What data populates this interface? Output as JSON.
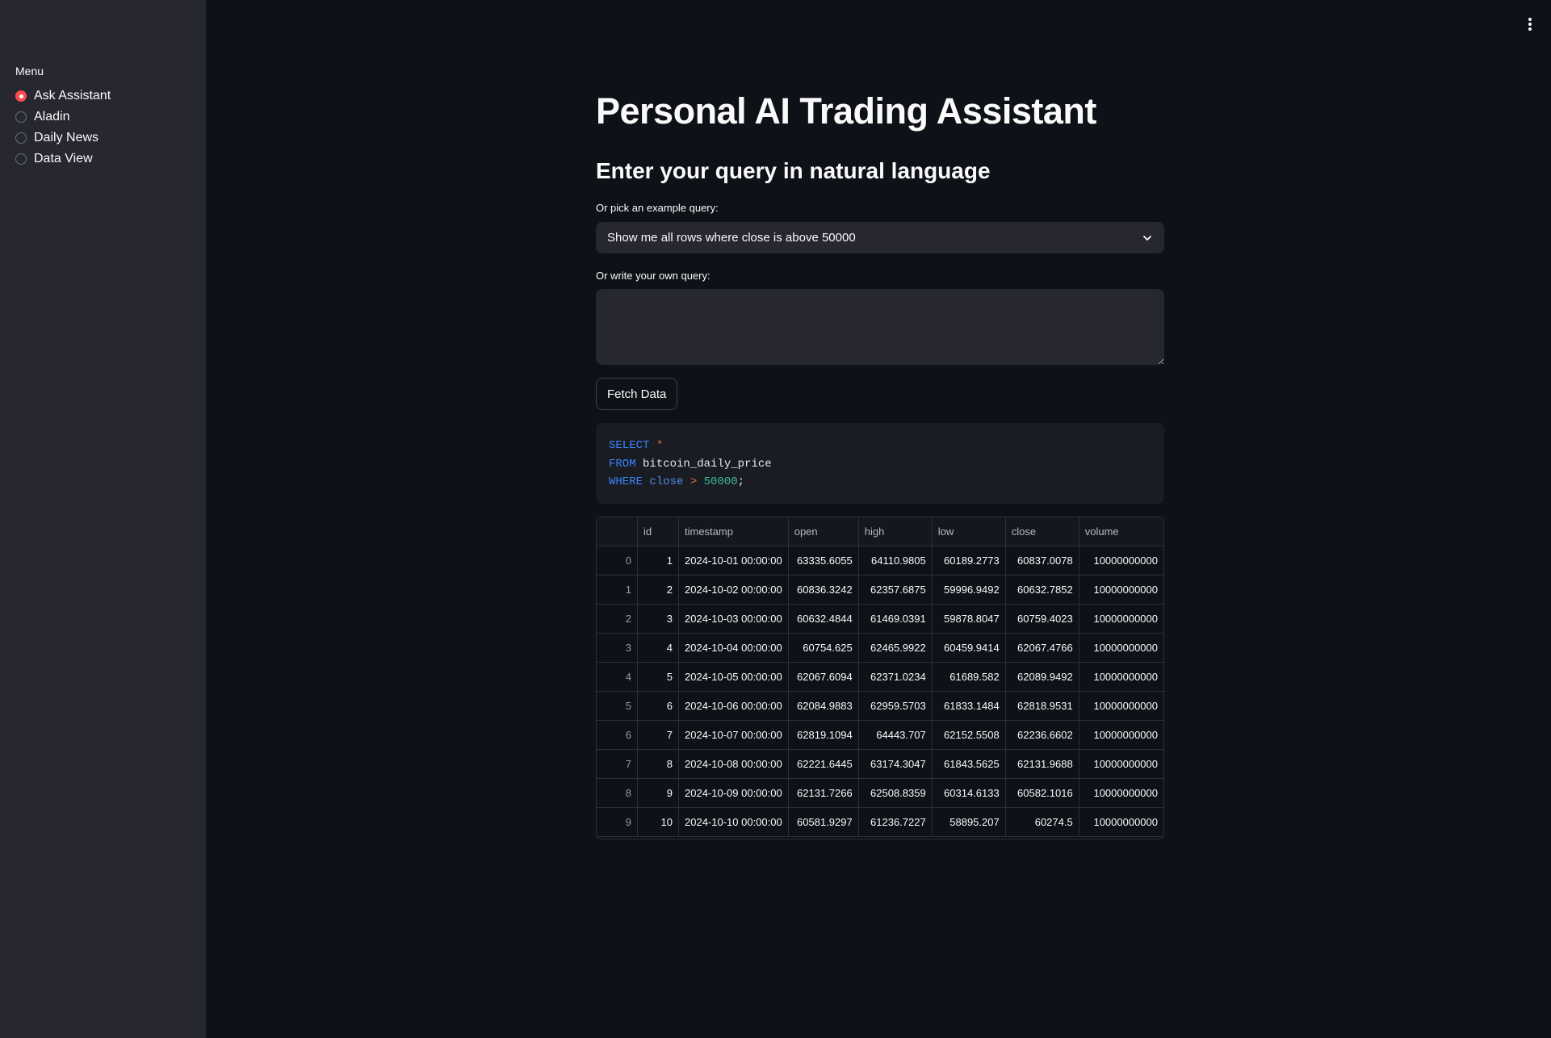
{
  "sidebar": {
    "menu_label": "Menu",
    "items": [
      {
        "label": "Ask Assistant",
        "selected": true
      },
      {
        "label": "Aladin",
        "selected": false
      },
      {
        "label": "Daily News",
        "selected": false
      },
      {
        "label": "Data View",
        "selected": false
      }
    ]
  },
  "header": {
    "menu_icon": "kebab-vertical-icon"
  },
  "main": {
    "title": "Personal AI Trading Assistant",
    "subtitle": "Enter your query in natural language",
    "example_label": "Or pick an example query:",
    "example_value": "Show me all rows where close is above 50000",
    "own_query_label": "Or write your own query:",
    "own_query_value": "",
    "fetch_button": "Fetch Data",
    "sql": {
      "l1_kw": "SELECT",
      "l1_op": "*",
      "l2_kw": "FROM",
      "l2_table": "bitcoin_daily_price",
      "l3_kw": "WHERE",
      "l3_col": "close",
      "l3_op": ">",
      "l3_num": "50000",
      "l3_end": ";"
    },
    "table": {
      "columns": [
        "",
        "id",
        "timestamp",
        "open",
        "high",
        "low",
        "close",
        "volume"
      ],
      "rows": [
        [
          "0",
          "1",
          "2024-10-01 00:00:00",
          "63335.6055",
          "64110.9805",
          "60189.2773",
          "60837.0078",
          "10000000000"
        ],
        [
          "1",
          "2",
          "2024-10-02 00:00:00",
          "60836.3242",
          "62357.6875",
          "59996.9492",
          "60632.7852",
          "10000000000"
        ],
        [
          "2",
          "3",
          "2024-10-03 00:00:00",
          "60632.4844",
          "61469.0391",
          "59878.8047",
          "60759.4023",
          "10000000000"
        ],
        [
          "3",
          "4",
          "2024-10-04 00:00:00",
          "60754.625",
          "62465.9922",
          "60459.9414",
          "62067.4766",
          "10000000000"
        ],
        [
          "4",
          "5",
          "2024-10-05 00:00:00",
          "62067.6094",
          "62371.0234",
          "61689.582",
          "62089.9492",
          "10000000000"
        ],
        [
          "5",
          "6",
          "2024-10-06 00:00:00",
          "62084.9883",
          "62959.5703",
          "61833.1484",
          "62818.9531",
          "10000000000"
        ],
        [
          "6",
          "7",
          "2024-10-07 00:00:00",
          "62819.1094",
          "64443.707",
          "62152.5508",
          "62236.6602",
          "10000000000"
        ],
        [
          "7",
          "8",
          "2024-10-08 00:00:00",
          "62221.6445",
          "63174.3047",
          "61843.5625",
          "62131.9688",
          "10000000000"
        ],
        [
          "8",
          "9",
          "2024-10-09 00:00:00",
          "62131.7266",
          "62508.8359",
          "60314.6133",
          "60582.1016",
          "10000000000"
        ],
        [
          "9",
          "10",
          "2024-10-10 00:00:00",
          "60581.9297",
          "61236.7227",
          "58895.207",
          "60274.5",
          "10000000000"
        ]
      ]
    }
  },
  "colors": {
    "accent": "#ff4b4b",
    "background": "#0e1117",
    "sidebar": "#262730"
  }
}
